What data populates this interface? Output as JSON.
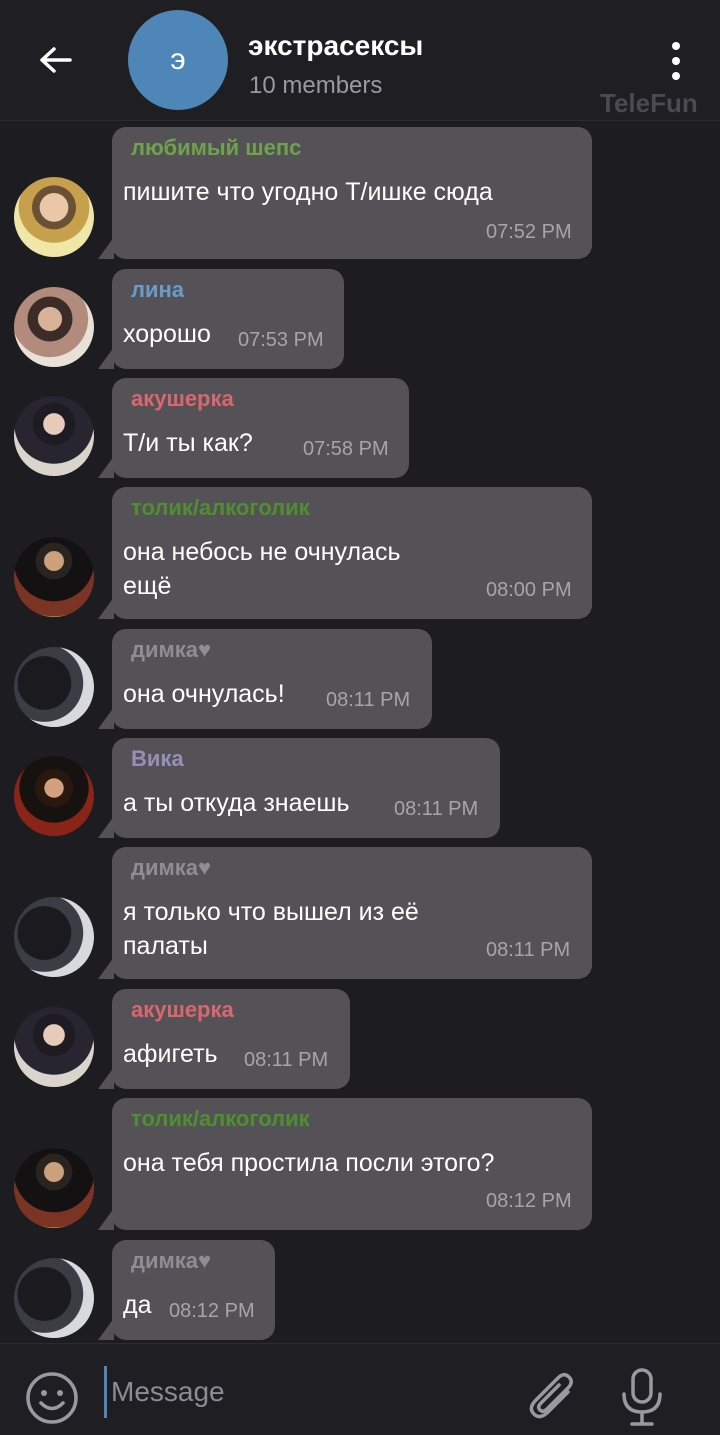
{
  "header": {
    "title": "экстрасексы",
    "subtitle": "10 members",
    "avatar_letter": "э",
    "watermark": "TeleFun"
  },
  "messages": [
    {
      "sender": "любимый шепс",
      "sender_color": "#6fa34a",
      "text": "пишите что угодно Т/ишке сюда",
      "time": "07:52 PM",
      "avatar": "av-shep"
    },
    {
      "sender": "лина",
      "sender_color": "#6a9cc9",
      "text": "хорошо",
      "time": "07:53 PM",
      "avatar": "av-lina"
    },
    {
      "sender": "акушерка",
      "sender_color": "#d9676d",
      "text": "Т/и  ты как?",
      "time": "07:58 PM",
      "avatar": "av-akush"
    },
    {
      "sender": "толик/алкоголик",
      "sender_color": "#4f8f2f",
      "text_lines": [
        "она небось не очнулась",
        "ещё"
      ],
      "time": "08:00 PM",
      "avatar": "av-tolik"
    },
    {
      "sender": "димка♥",
      "sender_color": "#8e8d93",
      "text": "она очнулась!",
      "time": "08:11 PM",
      "avatar": "av-dimka"
    },
    {
      "sender": "Вика",
      "sender_color": "#9590b8",
      "text": "а ты откуда знаешь",
      "time": "08:11 PM",
      "avatar": "av-vika"
    },
    {
      "sender": "димка♥",
      "sender_color": "#8e8d93",
      "text_lines": [
        "я только что вышел из её",
        "палаты"
      ],
      "time": "08:11 PM",
      "avatar": "av-dimka"
    },
    {
      "sender": "акушерка",
      "sender_color": "#d9676d",
      "text": "афигеть",
      "time": "08:11 PM",
      "avatar": "av-akush"
    },
    {
      "sender": "толик/алкоголик",
      "sender_color": "#4f8f2f",
      "text": "она тебя простила  посли этого?",
      "time": "08:12 PM",
      "avatar": "av-tolik"
    },
    {
      "sender": "димка♥",
      "sender_color": "#8e8d93",
      "text": "да",
      "time": "08:12 PM",
      "avatar": "av-dimka"
    }
  ],
  "composer": {
    "placeholder": "Message",
    "icons": [
      "smiley-icon",
      "paperclip-icon",
      "microphone-icon"
    ]
  }
}
